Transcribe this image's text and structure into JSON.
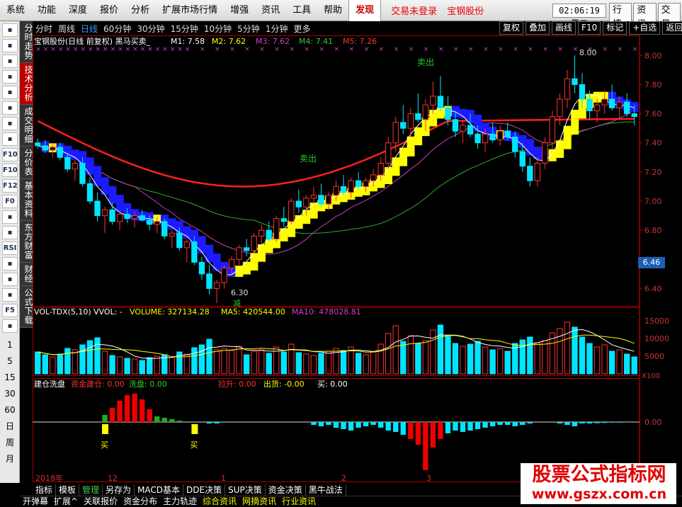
{
  "menu": {
    "items": [
      "系统",
      "功能",
      "深度",
      "报价",
      "分析",
      "扩展市场行情",
      "增强",
      "资讯",
      "工具",
      "帮助"
    ],
    "active": "发现",
    "login_status": "交易未登录",
    "stock_name": "宝钢股份",
    "clock": "02:06:19 周二",
    "right": [
      "行情",
      "资讯",
      "交易"
    ]
  },
  "left_tabs": [
    "分时走势",
    "技术分析",
    "成交明细",
    "分价表",
    "基本资料",
    "东方财富",
    "财经",
    "公式下载"
  ],
  "left_numbers": [
    "1",
    "5",
    "15",
    "30",
    "60",
    "日",
    "周",
    "月"
  ],
  "left_icons": [
    "back-icon",
    "up-icon",
    "down-icon",
    "book-icon",
    "grid-icon",
    "line-chart-icon",
    "candle-icon",
    "table-icon",
    "f10-icon",
    "f10b-icon",
    "f12-icon",
    "fog-icon",
    "bars-icon",
    "wave-icon",
    "rsi-icon",
    "money-icon",
    "move-icon",
    "pencil-icon",
    "f5-icon",
    "refresh-icon"
  ],
  "left_icon_labels": {
    "f10-icon": "F10",
    "f10b-icon": "F10",
    "f12-icon": "F12",
    "fog-icon": "F0",
    "rsi-icon": "RSI",
    "f5-icon": "F5"
  },
  "periods": [
    "分时",
    "周线",
    "日线",
    "60分钟",
    "30分钟",
    "15分钟",
    "10分钟",
    "5分钟",
    "1分钟",
    "更多"
  ],
  "period_selected": "日线",
  "chart_buttons": [
    "复权",
    "叠加",
    "画线",
    "F10",
    "标记",
    "+自选",
    "返回"
  ],
  "main_legend": {
    "title": "宝钢股份(日线 前复权) 黑马买卖_",
    "m1": "M1: 7.58",
    "m2": "M2: 7.62",
    "m3": "M3: 7.62",
    "m4": "M4: 7.41",
    "m5": "M5: 7.26"
  },
  "vol_legend": {
    "name": "VOL-TDX(5,10)",
    "vvol": "VVOL: -",
    "volume": "VOLUME: 327134.28",
    "ma5": "MA5: 420544.00",
    "ma10": "MA10: 478028.81"
  },
  "fund_legend": {
    "name": "建仓洗盘",
    "build": "资金建仓: 0.00",
    "wash": "洗盘: 0.00",
    "pull": "拉升: 0.00",
    "out": "出货: -0.00",
    "buy": "买: 0.00"
  },
  "annotations": {
    "sell1": "卖出",
    "sell2": "卖出",
    "low": "6.30",
    "reduce": "减",
    "high": "8.00",
    "buy1": "买",
    "buy2": "买",
    "x100": "X100"
  },
  "current_price": "6.46",
  "bottom_tabs": [
    "指标",
    "模板",
    "管理",
    "另存为",
    "MACD基本",
    "DDE决策",
    "SUP决策",
    "资金决策",
    "黑牛战法"
  ],
  "bottom_selected": "管理",
  "status_items": [
    "开弹幕",
    "扩展^",
    "关联报价",
    "资金分布",
    "主力轨迹",
    "综合资讯",
    "网摘资讯",
    "行业资讯"
  ],
  "watermark": {
    "line1": "股票公式指标网",
    "line2": "www.gszx.com.cn"
  },
  "colors": {
    "up": "#ff3232",
    "down": "#00e5ff",
    "ma_red": "#ff2020",
    "ma_green": "#2fa82f",
    "ma_magenta": "#c040c0",
    "ma_white": "#ffffff",
    "band_yellow": "#ffff00",
    "band_blue": "#1b1bff"
  },
  "chart_data": {
    "type": "candlestick",
    "y_axis": [
      "8.00",
      "7.80",
      "7.60",
      "7.40",
      "7.20",
      "7.00",
      "6.80",
      "6.60",
      "6.40"
    ],
    "ylim": [
      6.3,
      8.05
    ],
    "x_labels": [
      "2018年",
      "12",
      "1",
      "2",
      "3"
    ],
    "vol_axis": [
      "15000",
      "10000",
      "5000"
    ],
    "fund_axis": [
      "0.00"
    ],
    "candles": [
      [
        7.4,
        7.43,
        7.36,
        7.38
      ],
      [
        7.38,
        7.42,
        7.33,
        7.35
      ],
      [
        7.35,
        7.39,
        7.3,
        7.37
      ],
      [
        7.37,
        7.4,
        7.28,
        7.3
      ],
      [
        7.3,
        7.33,
        7.2,
        7.22
      ],
      [
        7.22,
        7.28,
        7.14,
        7.26
      ],
      [
        7.26,
        7.3,
        7.1,
        7.12
      ],
      [
        7.12,
        7.16,
        6.98,
        7.0
      ],
      [
        7.0,
        7.06,
        6.86,
        6.9
      ],
      [
        6.9,
        6.96,
        6.78,
        6.94
      ],
      [
        6.94,
        6.99,
        6.84,
        6.86
      ],
      [
        6.86,
        6.92,
        6.8,
        6.91
      ],
      [
        6.91,
        6.95,
        6.85,
        6.88
      ],
      [
        6.88,
        6.93,
        6.82,
        6.9
      ],
      [
        6.9,
        6.94,
        6.86,
        6.87
      ],
      [
        6.87,
        6.9,
        6.8,
        6.84
      ],
      [
        6.84,
        6.89,
        6.78,
        6.86
      ],
      [
        6.86,
        6.88,
        6.74,
        6.76
      ],
      [
        6.76,
        6.8,
        6.68,
        6.78
      ],
      [
        6.78,
        6.82,
        6.66,
        6.68
      ],
      [
        6.68,
        6.74,
        6.58,
        6.72
      ],
      [
        6.72,
        6.76,
        6.56,
        6.58
      ],
      [
        6.58,
        6.62,
        6.46,
        6.5
      ],
      [
        6.5,
        6.56,
        6.36,
        6.4
      ],
      [
        6.4,
        6.46,
        6.3,
        6.44
      ],
      [
        6.44,
        6.56,
        6.4,
        6.54
      ],
      [
        6.54,
        6.62,
        6.5,
        6.6
      ],
      [
        6.6,
        6.7,
        6.56,
        6.68
      ],
      [
        6.68,
        6.74,
        6.62,
        6.66
      ],
      [
        6.66,
        6.78,
        6.64,
        6.76
      ],
      [
        6.76,
        6.84,
        6.7,
        6.8
      ],
      [
        6.8,
        6.86,
        6.72,
        6.74
      ],
      [
        6.74,
        6.9,
        6.72,
        6.88
      ],
      [
        6.88,
        6.96,
        6.82,
        6.86
      ],
      [
        6.86,
        7.02,
        6.84,
        7.0
      ],
      [
        7.0,
        7.08,
        6.92,
        6.96
      ],
      [
        6.96,
        7.04,
        6.9,
        7.02
      ],
      [
        7.02,
        7.1,
        6.98,
        7.04
      ],
      [
        7.04,
        7.12,
        6.96,
        6.98
      ],
      [
        6.98,
        7.06,
        6.94,
        7.04
      ],
      [
        7.04,
        7.14,
        7.0,
        7.1
      ],
      [
        7.1,
        7.18,
        7.04,
        7.06
      ],
      [
        7.06,
        7.16,
        7.02,
        7.14
      ],
      [
        7.14,
        7.2,
        7.08,
        7.1
      ],
      [
        7.1,
        7.16,
        7.06,
        7.14
      ],
      [
        7.14,
        7.22,
        7.1,
        7.18
      ],
      [
        7.18,
        7.3,
        7.14,
        7.26
      ],
      [
        7.26,
        7.44,
        7.22,
        7.4
      ],
      [
        7.4,
        7.58,
        7.34,
        7.54
      ],
      [
        7.54,
        7.66,
        7.46,
        7.5
      ],
      [
        7.5,
        7.64,
        7.44,
        7.6
      ],
      [
        7.6,
        7.74,
        7.54,
        7.56
      ],
      [
        7.56,
        7.7,
        7.48,
        7.66
      ],
      [
        7.66,
        7.82,
        7.6,
        7.72
      ],
      [
        7.72,
        7.86,
        7.62,
        7.64
      ],
      [
        7.64,
        7.72,
        7.52,
        7.56
      ],
      [
        7.56,
        7.62,
        7.44,
        7.48
      ],
      [
        7.48,
        7.56,
        7.4,
        7.52
      ],
      [
        7.52,
        7.6,
        7.44,
        7.46
      ],
      [
        7.46,
        7.52,
        7.36,
        7.4
      ],
      [
        7.4,
        7.5,
        7.34,
        7.46
      ],
      [
        7.46,
        7.54,
        7.4,
        7.42
      ],
      [
        7.42,
        7.52,
        7.38,
        7.48
      ],
      [
        7.48,
        7.54,
        7.42,
        7.44
      ],
      [
        7.44,
        7.48,
        7.3,
        7.34
      ],
      [
        7.34,
        7.4,
        7.2,
        7.24
      ],
      [
        7.24,
        7.3,
        7.1,
        7.14
      ],
      [
        7.14,
        7.3,
        7.1,
        7.26
      ],
      [
        7.26,
        7.44,
        7.22,
        7.4
      ],
      [
        7.4,
        7.62,
        7.36,
        7.58
      ],
      [
        7.58,
        7.74,
        7.52,
        7.7
      ],
      [
        7.7,
        7.9,
        7.64,
        7.84
      ],
      [
        7.84,
        8.0,
        7.74,
        7.8
      ],
      [
        7.8,
        7.88,
        7.64,
        7.7
      ],
      [
        7.7,
        7.76,
        7.56,
        7.62
      ],
      [
        7.62,
        7.7,
        7.54,
        7.66
      ],
      [
        7.66,
        7.76,
        7.6,
        7.7
      ],
      [
        7.7,
        7.8,
        7.62,
        7.64
      ],
      [
        7.64,
        7.72,
        7.56,
        7.68
      ],
      [
        7.68,
        7.74,
        7.58,
        7.6
      ],
      [
        7.6,
        7.66,
        7.52,
        7.58
      ]
    ],
    "volumes": [
      6200,
      5400,
      4800,
      5600,
      7200,
      6800,
      8200,
      9400,
      10200,
      6400,
      5200,
      4800,
      4400,
      4200,
      3800,
      4600,
      5000,
      5400,
      4600,
      6200,
      5600,
      7400,
      8200,
      9800,
      6800,
      7200,
      6600,
      7800,
      5400,
      6400,
      6800,
      5800,
      7600,
      6200,
      8400,
      6000,
      5600,
      5200,
      5800,
      6400,
      7200,
      6600,
      7600,
      5800,
      5400,
      6200,
      8400,
      11400,
      13600,
      9200,
      10800,
      8600,
      9400,
      12400,
      13800,
      10600,
      8600,
      7800,
      8400,
      9200,
      7600,
      6800,
      7200,
      6400,
      8600,
      9600,
      10400,
      8800,
      9400,
      11600,
      12800,
      14600,
      13200,
      10400,
      8600,
      7600,
      8200,
      6400,
      6800,
      5600,
      4800
    ],
    "funds": [
      0,
      0,
      0,
      0,
      0,
      0,
      0,
      0,
      0,
      0.25,
      0.5,
      0.75,
      0.95,
      1.0,
      0.8,
      0.45,
      0.2,
      0.15,
      0.1,
      0.05,
      0,
      0,
      0,
      -0.05,
      -0.05,
      0,
      0,
      0,
      0,
      0,
      0,
      0,
      0,
      0,
      0,
      0,
      0,
      -0.1,
      -0.15,
      -0.1,
      -0.2,
      -0.25,
      -0.3,
      -0.2,
      -0.15,
      -0.1,
      -0.2,
      -0.3,
      -0.35,
      -0.45,
      -0.6,
      -0.8,
      -1.7,
      -0.9,
      -0.6,
      -0.4,
      -0.3,
      -0.35,
      -0.3,
      -0.25,
      -0.2,
      -0.15,
      -0.1,
      -0.1,
      -0.15,
      -0.1,
      -0.05,
      0,
      0,
      0,
      -0.05,
      -0.1,
      -0.15,
      -0.05,
      -0.05,
      -0.04,
      -0.03,
      -0.02,
      -0.02,
      -0.01,
      0
    ]
  }
}
